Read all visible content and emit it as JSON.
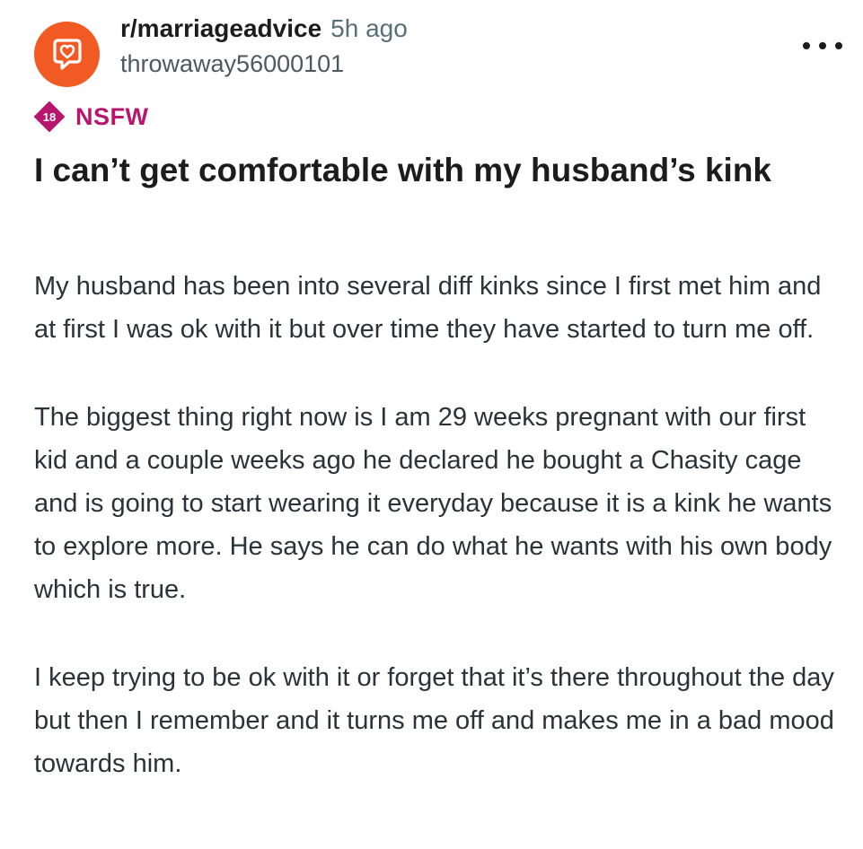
{
  "post": {
    "subreddit": "r/marriageadvice",
    "time": "5h ago",
    "username": "throwaway56000101",
    "nsfw": {
      "badge_number": "18",
      "label": "NSFW"
    },
    "title": "I can’t get comfortable with my husband’s kink",
    "paragraphs": [
      "My husband has been into several diff kinks since I first met him and at first I was ok with it but over time they have started to turn me off.",
      "The biggest thing right now is I am 29 weeks pregnant with our first kid and a couple weeks ago he declared he bought a Chasity cage and is going to start wearing it everyday because it is a kink he wants to explore more. He says he can do what he wants with his own body which is true.",
      "I keep trying to be ok with it or forget that it’s there throughout the day but then I remember and it turns me off and makes me in a bad mood towards him."
    ]
  },
  "icons": {
    "avatar": "speech-bubble-heart-icon",
    "more": "more-options-icon",
    "nsfw": "nsfw-18-icon"
  },
  "colors": {
    "avatar_bg": "#f15a22",
    "nsfw": "#b8166d",
    "meta_gray": "#576f76"
  }
}
